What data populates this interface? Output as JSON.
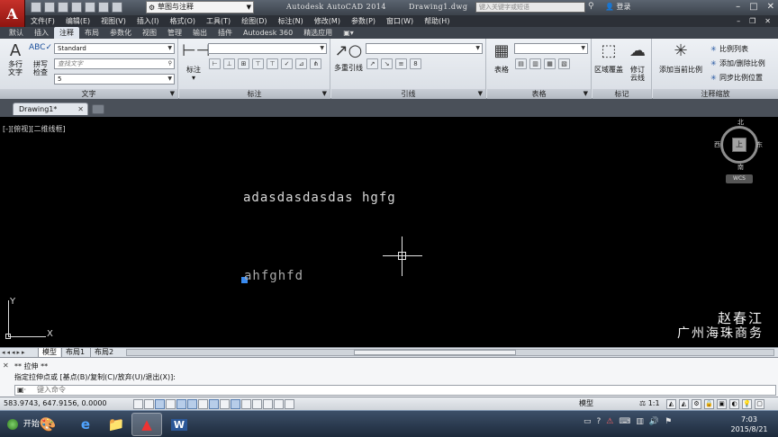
{
  "app": {
    "logo": "A",
    "workspace": "草图与注释",
    "title_app": "Autodesk AutoCAD 2014",
    "title_file": "Drawing1.dwg",
    "search_placeholder": "键入关键字或短语",
    "login": "登录"
  },
  "menu": [
    "文件(F)",
    "编辑(E)",
    "视图(V)",
    "插入(I)",
    "格式(O)",
    "工具(T)",
    "绘图(D)",
    "标注(N)",
    "修改(M)",
    "参数(P)",
    "窗口(W)",
    "帮助(H)"
  ],
  "ribbon_tabs": [
    "默认",
    "插入",
    "注释",
    "布局",
    "参数化",
    "视图",
    "管理",
    "输出",
    "插件",
    "Autodesk 360",
    "精选应用"
  ],
  "ribbon_active": "注释",
  "ribbon": {
    "text_panel": {
      "title": "文字",
      "mtext_label": "多行\n文字",
      "spell_label": "拼写\n检查",
      "style_value": "Standard",
      "find_placeholder": "查找文字",
      "height_value": "5"
    },
    "dim_panel": {
      "title": "标注",
      "dim_label": "标注"
    },
    "leader_panel": {
      "title": "引线",
      "mleader_label": "多重引线"
    },
    "table_panel": {
      "title": "表格",
      "table_label": "表格"
    },
    "markup_panel": {
      "title": "标记",
      "wipeout_label": "区域覆盖",
      "revcloud_label": "修订\n云线"
    },
    "scale_panel": {
      "title": "注释缩放",
      "add_current_label": "添加当前比例",
      "scale_list": "比例列表",
      "add_delete": "添加/删除比例",
      "sync_scale": "同步比例位置"
    }
  },
  "doc_tab": "Drawing1*",
  "viewport_label": "[-][俯视][二维线框]",
  "canvas": {
    "text1": "adasdasdasdas  hgfg",
    "text2": "ahfghfd",
    "ucs_x": "X",
    "ucs_y": "Y"
  },
  "viewcube": {
    "face": "上",
    "north": "北",
    "south": "南",
    "east": "东",
    "west": "西",
    "wcs": "WCS"
  },
  "watermark": {
    "line1": "赵春江",
    "line2": "广州海珠商务"
  },
  "layout_tabs": [
    "模型",
    "布局1",
    "布局2"
  ],
  "command": {
    "line1": "** 拉伸 **",
    "line2": "指定拉伸点或 [基点(B)/复制(C)/放弃(U)/退出(X)]:",
    "input_placeholder": "键入命令"
  },
  "status": {
    "coords": "583.9743, 647.9156, 0.0000",
    "model": "模型",
    "scale": "1:1"
  },
  "taskbar": {
    "start": "开始",
    "time": "7:03",
    "date": "2015/8/21"
  }
}
